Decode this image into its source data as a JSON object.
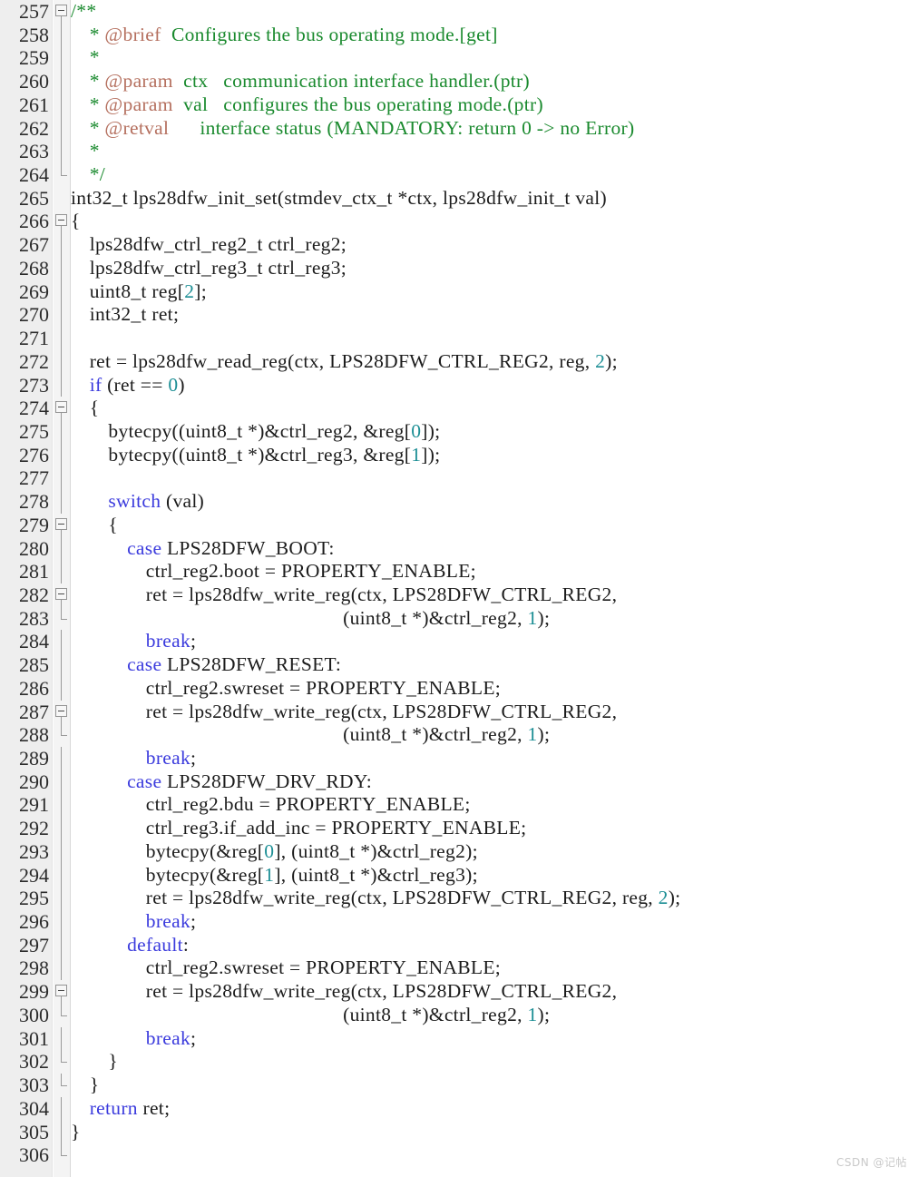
{
  "editor": {
    "kind": "source-code-viewer",
    "language": "C",
    "first_line": 257,
    "last_line": 306,
    "colors": {
      "background": "#ffffff",
      "gutter_background": "#eeeeee",
      "fold_background": "#f4f4f4",
      "line_number": "#2b2b2b",
      "plain_text": "#1c1c1c",
      "comment": "#1a8a2e",
      "doc_tag": "#b5705f",
      "keyword": "#3b3bdd",
      "number": "#1d8f95",
      "watermark": "#c9c9c9"
    }
  },
  "watermark": {
    "text": "CSDN @记帖"
  },
  "lines": [
    {
      "n": 257,
      "fold": "box",
      "indent": 0,
      "tokens": [
        {
          "t": "/**",
          "c": "cm"
        }
      ]
    },
    {
      "n": 258,
      "fold": "line",
      "indent": 2,
      "tokens": [
        {
          "t": "* ",
          "c": "cm"
        },
        {
          "t": "@brief",
          "c": "tag"
        },
        {
          "t": "  Configures the bus operating mode.[get]",
          "c": "cm"
        }
      ]
    },
    {
      "n": 259,
      "fold": "line",
      "indent": 2,
      "tokens": [
        {
          "t": "*",
          "c": "cm"
        }
      ]
    },
    {
      "n": 260,
      "fold": "line",
      "indent": 2,
      "tokens": [
        {
          "t": "* ",
          "c": "cm"
        },
        {
          "t": "@param",
          "c": "tag"
        },
        {
          "t": "  ctx   communication interface handler.(ptr)",
          "c": "cm"
        }
      ]
    },
    {
      "n": 261,
      "fold": "line",
      "indent": 2,
      "tokens": [
        {
          "t": "* ",
          "c": "cm"
        },
        {
          "t": "@param",
          "c": "tag"
        },
        {
          "t": "  val   configures the bus operating mode.(ptr)",
          "c": "cm"
        }
      ]
    },
    {
      "n": 262,
      "fold": "line",
      "indent": 2,
      "tokens": [
        {
          "t": "* ",
          "c": "cm"
        },
        {
          "t": "@retval",
          "c": "tag"
        },
        {
          "t": "      interface status (MANDATORY: return 0 -> no Error)",
          "c": "cm"
        }
      ]
    },
    {
      "n": 263,
      "fold": "line",
      "indent": 2,
      "tokens": [
        {
          "t": "*",
          "c": "cm"
        }
      ]
    },
    {
      "n": 264,
      "fold": "end",
      "indent": 2,
      "tokens": [
        {
          "t": "*/",
          "c": "cm"
        }
      ]
    },
    {
      "n": 265,
      "fold": "none",
      "indent": 0,
      "tokens": [
        {
          "t": "int32_t lps28dfw_init_set(stmdev_ctx_t *ctx, lps28dfw_init_t val)",
          "c": "pl"
        }
      ]
    },
    {
      "n": 266,
      "fold": "box",
      "indent": 0,
      "tokens": [
        {
          "t": "{",
          "c": "pl"
        }
      ]
    },
    {
      "n": 267,
      "fold": "line",
      "indent": 2,
      "tokens": [
        {
          "t": "lps28dfw_ctrl_reg2_t ctrl_reg2;",
          "c": "pl"
        }
      ]
    },
    {
      "n": 268,
      "fold": "line",
      "indent": 2,
      "tokens": [
        {
          "t": "lps28dfw_ctrl_reg3_t ctrl_reg3;",
          "c": "pl"
        }
      ]
    },
    {
      "n": 269,
      "fold": "line",
      "indent": 2,
      "tokens": [
        {
          "t": "uint8_t reg[",
          "c": "pl"
        },
        {
          "t": "2",
          "c": "num"
        },
        {
          "t": "];",
          "c": "pl"
        }
      ]
    },
    {
      "n": 270,
      "fold": "line",
      "indent": 2,
      "tokens": [
        {
          "t": "int32_t ret;",
          "c": "pl"
        }
      ]
    },
    {
      "n": 271,
      "fold": "line",
      "indent": 0,
      "tokens": []
    },
    {
      "n": 272,
      "fold": "line",
      "indent": 2,
      "tokens": [
        {
          "t": "ret = lps28dfw_read_reg(ctx, LPS28DFW_CTRL_REG2, reg, ",
          "c": "pl"
        },
        {
          "t": "2",
          "c": "num"
        },
        {
          "t": ");",
          "c": "pl"
        }
      ]
    },
    {
      "n": 273,
      "fold": "line",
      "indent": 2,
      "tokens": [
        {
          "t": "if",
          "c": "kw"
        },
        {
          "t": " (ret == ",
          "c": "pl"
        },
        {
          "t": "0",
          "c": "num"
        },
        {
          "t": ")",
          "c": "pl"
        }
      ]
    },
    {
      "n": 274,
      "fold": "box",
      "indent": 2,
      "tokens": [
        {
          "t": "{",
          "c": "pl"
        }
      ]
    },
    {
      "n": 275,
      "fold": "line",
      "indent": 4,
      "tokens": [
        {
          "t": "bytecpy((uint8_t *)&ctrl_reg2, &reg[",
          "c": "pl"
        },
        {
          "t": "0",
          "c": "num"
        },
        {
          "t": "]);",
          "c": "pl"
        }
      ]
    },
    {
      "n": 276,
      "fold": "line",
      "indent": 4,
      "tokens": [
        {
          "t": "bytecpy((uint8_t *)&ctrl_reg3, &reg[",
          "c": "pl"
        },
        {
          "t": "1",
          "c": "num"
        },
        {
          "t": "]);",
          "c": "pl"
        }
      ]
    },
    {
      "n": 277,
      "fold": "line",
      "indent": 0,
      "tokens": []
    },
    {
      "n": 278,
      "fold": "line",
      "indent": 4,
      "tokens": [
        {
          "t": "switch",
          "c": "kw"
        },
        {
          "t": " (val)",
          "c": "pl"
        }
      ]
    },
    {
      "n": 279,
      "fold": "box",
      "indent": 4,
      "tokens": [
        {
          "t": "{",
          "c": "pl"
        }
      ]
    },
    {
      "n": 280,
      "fold": "line",
      "indent": 6,
      "tokens": [
        {
          "t": "case",
          "c": "kw"
        },
        {
          "t": " LPS28DFW_BOOT:",
          "c": "pl"
        }
      ]
    },
    {
      "n": 281,
      "fold": "line",
      "indent": 8,
      "tokens": [
        {
          "t": "ctrl_reg2.boot = PROPERTY_ENABLE;",
          "c": "pl"
        }
      ]
    },
    {
      "n": 282,
      "fold": "box",
      "indent": 8,
      "tokens": [
        {
          "t": "ret = lps28dfw_write_reg(ctx, LPS28DFW_CTRL_REG2,",
          "c": "pl"
        }
      ]
    },
    {
      "n": 283,
      "fold": "end",
      "indent": 29,
      "tokens": [
        {
          "t": "(uint8_t *)&ctrl_reg2, ",
          "c": "pl"
        },
        {
          "t": "1",
          "c": "num"
        },
        {
          "t": ");",
          "c": "pl"
        }
      ]
    },
    {
      "n": 284,
      "fold": "line",
      "indent": 8,
      "tokens": [
        {
          "t": "break",
          "c": "kw"
        },
        {
          "t": ";",
          "c": "pl"
        }
      ]
    },
    {
      "n": 285,
      "fold": "line",
      "indent": 6,
      "tokens": [
        {
          "t": "case",
          "c": "kw"
        },
        {
          "t": " LPS28DFW_RESET:",
          "c": "pl"
        }
      ]
    },
    {
      "n": 286,
      "fold": "line",
      "indent": 8,
      "tokens": [
        {
          "t": "ctrl_reg2.swreset = PROPERTY_ENABLE;",
          "c": "pl"
        }
      ]
    },
    {
      "n": 287,
      "fold": "box",
      "indent": 8,
      "tokens": [
        {
          "t": "ret = lps28dfw_write_reg(ctx, LPS28DFW_CTRL_REG2,",
          "c": "pl"
        }
      ]
    },
    {
      "n": 288,
      "fold": "end",
      "indent": 29,
      "tokens": [
        {
          "t": "(uint8_t *)&ctrl_reg2, ",
          "c": "pl"
        },
        {
          "t": "1",
          "c": "num"
        },
        {
          "t": ");",
          "c": "pl"
        }
      ]
    },
    {
      "n": 289,
      "fold": "line",
      "indent": 8,
      "tokens": [
        {
          "t": "break",
          "c": "kw"
        },
        {
          "t": ";",
          "c": "pl"
        }
      ]
    },
    {
      "n": 290,
      "fold": "line",
      "indent": 6,
      "tokens": [
        {
          "t": "case",
          "c": "kw"
        },
        {
          "t": " LPS28DFW_DRV_RDY:",
          "c": "pl"
        }
      ]
    },
    {
      "n": 291,
      "fold": "line",
      "indent": 8,
      "tokens": [
        {
          "t": "ctrl_reg2.bdu = PROPERTY_ENABLE;",
          "c": "pl"
        }
      ]
    },
    {
      "n": 292,
      "fold": "line",
      "indent": 8,
      "tokens": [
        {
          "t": "ctrl_reg3.if_add_inc = PROPERTY_ENABLE;",
          "c": "pl"
        }
      ]
    },
    {
      "n": 293,
      "fold": "line",
      "indent": 8,
      "tokens": [
        {
          "t": "bytecpy(&reg[",
          "c": "pl"
        },
        {
          "t": "0",
          "c": "num"
        },
        {
          "t": "], (uint8_t *)&ctrl_reg2);",
          "c": "pl"
        }
      ]
    },
    {
      "n": 294,
      "fold": "line",
      "indent": 8,
      "tokens": [
        {
          "t": "bytecpy(&reg[",
          "c": "pl"
        },
        {
          "t": "1",
          "c": "num"
        },
        {
          "t": "], (uint8_t *)&ctrl_reg3);",
          "c": "pl"
        }
      ]
    },
    {
      "n": 295,
      "fold": "line",
      "indent": 8,
      "tokens": [
        {
          "t": "ret = lps28dfw_write_reg(ctx, LPS28DFW_CTRL_REG2, reg, ",
          "c": "pl"
        },
        {
          "t": "2",
          "c": "num"
        },
        {
          "t": ");",
          "c": "pl"
        }
      ]
    },
    {
      "n": 296,
      "fold": "line",
      "indent": 8,
      "tokens": [
        {
          "t": "break",
          "c": "kw"
        },
        {
          "t": ";",
          "c": "pl"
        }
      ]
    },
    {
      "n": 297,
      "fold": "line",
      "indent": 6,
      "tokens": [
        {
          "t": "default",
          "c": "kw"
        },
        {
          "t": ":",
          "c": "pl"
        }
      ]
    },
    {
      "n": 298,
      "fold": "line",
      "indent": 8,
      "tokens": [
        {
          "t": "ctrl_reg2.swreset = PROPERTY_ENABLE;",
          "c": "pl"
        }
      ]
    },
    {
      "n": 299,
      "fold": "box",
      "indent": 8,
      "tokens": [
        {
          "t": "ret = lps28dfw_write_reg(ctx, LPS28DFW_CTRL_REG2,",
          "c": "pl"
        }
      ]
    },
    {
      "n": 300,
      "fold": "end",
      "indent": 29,
      "tokens": [
        {
          "t": "(uint8_t *)&ctrl_reg2, ",
          "c": "pl"
        },
        {
          "t": "1",
          "c": "num"
        },
        {
          "t": ");",
          "c": "pl"
        }
      ]
    },
    {
      "n": 301,
      "fold": "line",
      "indent": 8,
      "tokens": [
        {
          "t": "break",
          "c": "kw"
        },
        {
          "t": ";",
          "c": "pl"
        }
      ]
    },
    {
      "n": 302,
      "fold": "end",
      "indent": 4,
      "tokens": [
        {
          "t": "}",
          "c": "pl"
        }
      ]
    },
    {
      "n": 303,
      "fold": "end",
      "indent": 2,
      "tokens": [
        {
          "t": "}",
          "c": "pl"
        }
      ]
    },
    {
      "n": 304,
      "fold": "line",
      "indent": 2,
      "tokens": [
        {
          "t": "return",
          "c": "kw"
        },
        {
          "t": " ret;",
          "c": "pl"
        }
      ]
    },
    {
      "n": 305,
      "fold": "line",
      "indent": 0,
      "tokens": [
        {
          "t": "}",
          "c": "pl"
        }
      ]
    },
    {
      "n": 306,
      "fold": "end",
      "indent": 0,
      "tokens": []
    }
  ]
}
